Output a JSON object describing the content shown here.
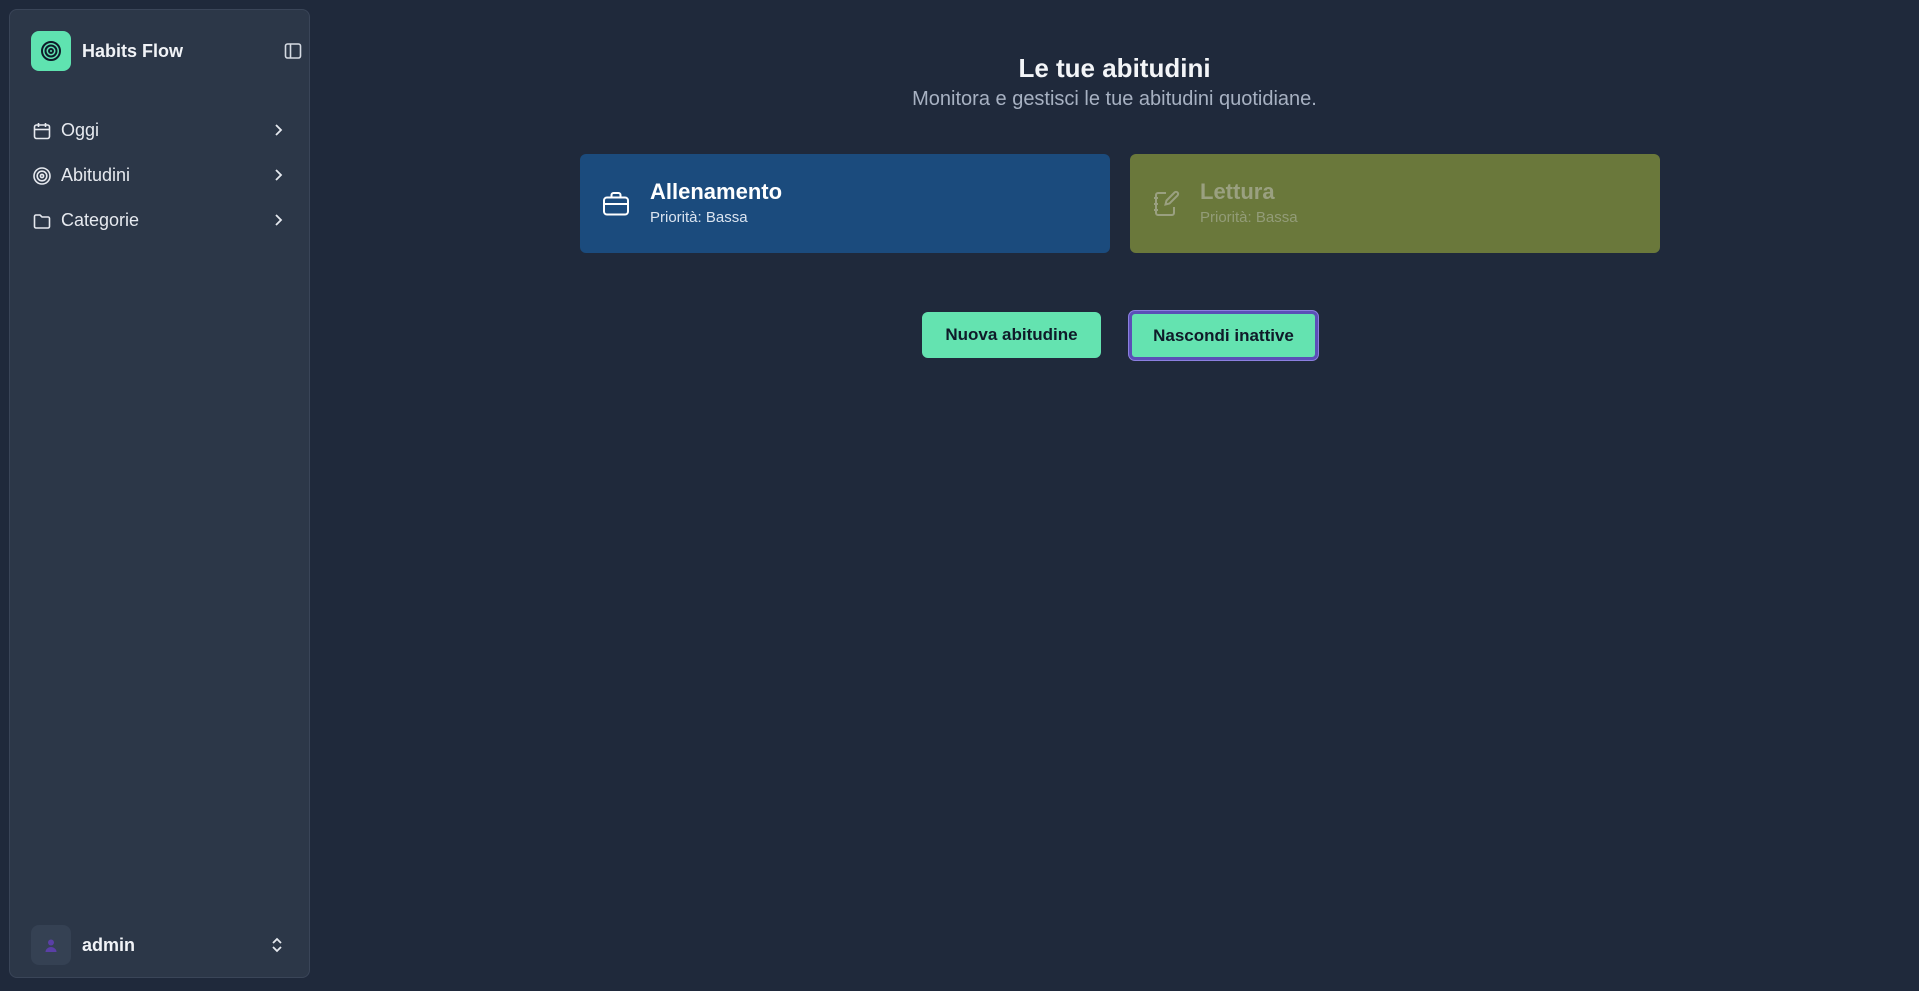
{
  "sidebar": {
    "brand": {
      "name": "Habits Flow",
      "icon": "target-icon"
    },
    "collapse_icon": "sidebar-toggle-icon",
    "items": [
      {
        "label": "Oggi",
        "icon": "calendar-icon"
      },
      {
        "label": "Abitudini",
        "icon": "target-icon"
      },
      {
        "label": "Categorie",
        "icon": "folder-icon"
      }
    ],
    "user": {
      "name": "admin",
      "icon": "user-icon"
    }
  },
  "main": {
    "title": "Le tue abitudini",
    "subtitle": "Monitora e gestisci le tue abitudini quotidiane.",
    "habits": [
      {
        "name": "Allenamento",
        "priority": "Priorità: Bassa",
        "icon": "briefcase-icon",
        "color": "#1b4b7d",
        "active": true
      },
      {
        "name": "Lettura",
        "priority": "Priorità: Bassa",
        "icon": "notebook-pen-icon",
        "color": "#6a783b",
        "active": false
      }
    ],
    "buttons": {
      "new_habit": "Nuova abitudine",
      "hide_inactive": "Nascondi inattive"
    }
  },
  "colors": {
    "accent": "#64e3b0",
    "background": "#1f293b",
    "sidebar": "#2c3748",
    "focus_ring": "#5b4fb7"
  }
}
